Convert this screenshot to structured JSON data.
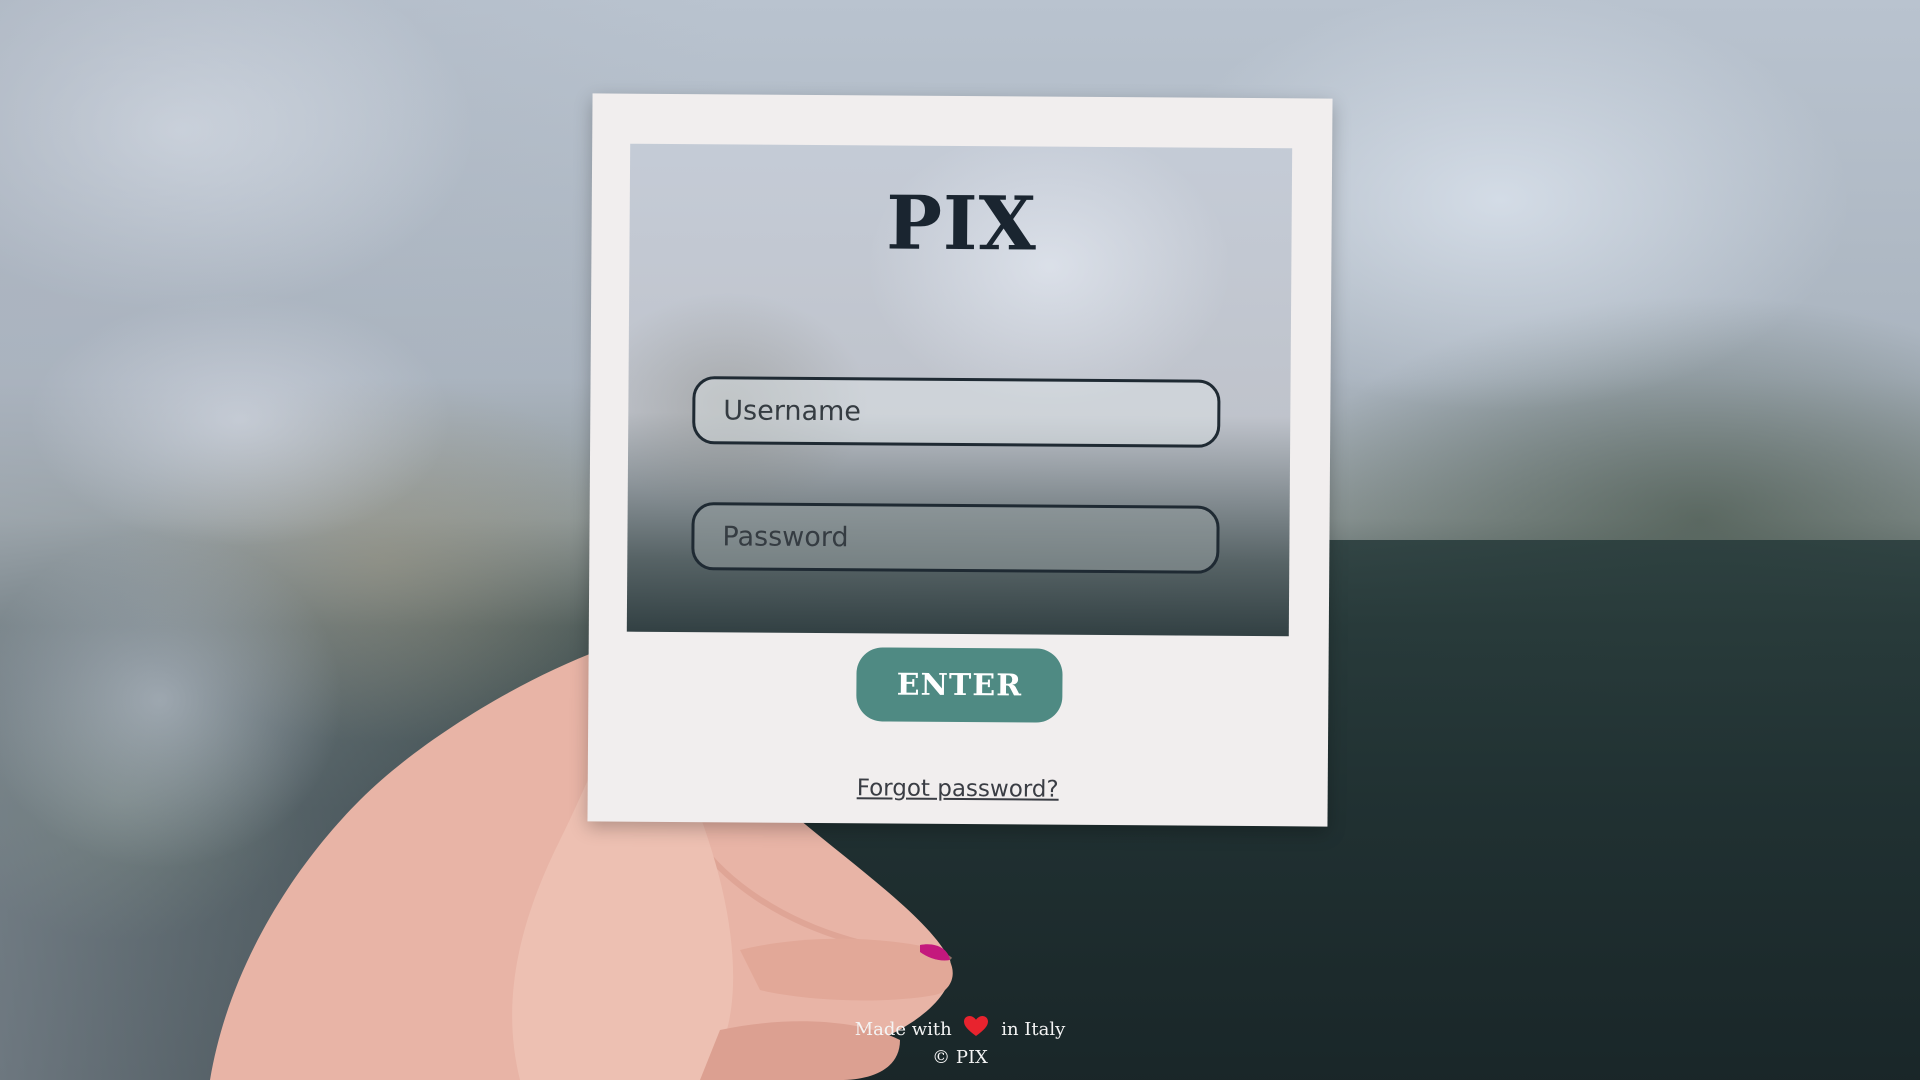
{
  "brand": {
    "title": "PIX"
  },
  "login": {
    "username_placeholder": "Username",
    "password_placeholder": "Password",
    "submit_label": "ENTER",
    "forgot_label": "Forgot password?"
  },
  "footer": {
    "made_with": "Made with",
    "heart_icon": "heart-icon",
    "in_country": "in Italy",
    "copyright": "© PIX"
  },
  "colors": {
    "accent": "#4f8a83",
    "heart": "#e8232e",
    "frame": "#f1eeee",
    "text_dark": "#1a2530"
  }
}
